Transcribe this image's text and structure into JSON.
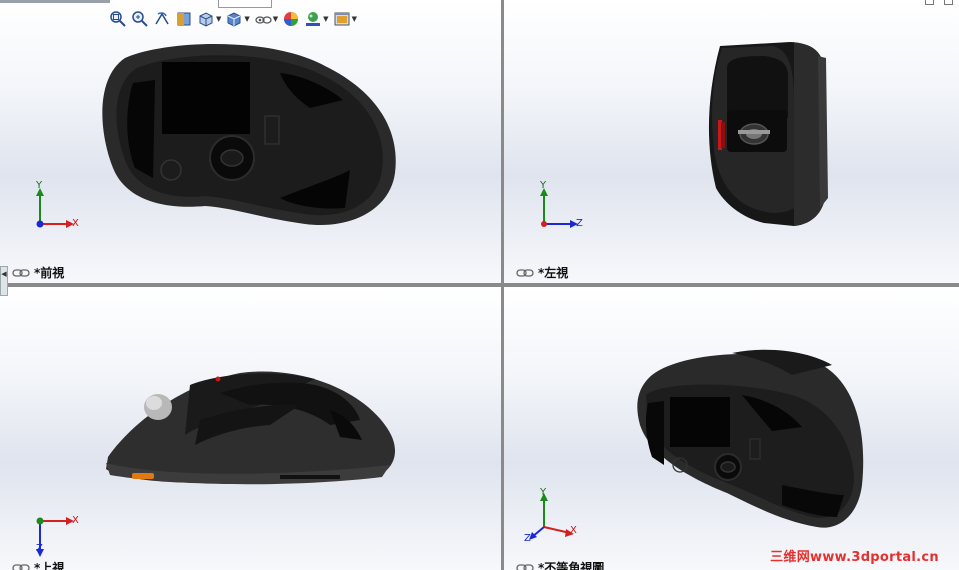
{
  "toolbar": {
    "buttons": [
      {
        "icon": "zoom-to-fit-icon",
        "dropdown": false
      },
      {
        "icon": "zoom-to-area-icon",
        "dropdown": false
      },
      {
        "icon": "previous-view-icon",
        "dropdown": false
      },
      {
        "icon": "section-view-icon",
        "dropdown": false
      },
      {
        "icon": "view-orientation-icon",
        "dropdown": true
      },
      {
        "icon": "display-style-icon",
        "dropdown": true
      },
      {
        "icon": "hide-show-items-icon",
        "dropdown": true
      },
      {
        "icon": "edit-appearance-icon",
        "dropdown": false
      },
      {
        "icon": "apply-scene-icon",
        "dropdown": true
      },
      {
        "icon": "view-settings-icon",
        "dropdown": true
      }
    ]
  },
  "viewports": {
    "front": {
      "label": "*前視",
      "axes": [
        "Y",
        "X"
      ]
    },
    "left": {
      "label": "*左視",
      "axes": [
        "Y",
        "Z"
      ]
    },
    "top": {
      "label": "*上視",
      "axes": [
        "X",
        "Z"
      ]
    },
    "iso": {
      "label": "*不等角視圖",
      "axes": [
        "Y",
        "X",
        "Z"
      ]
    }
  },
  "watermark": "三维网www.3dportal.cn",
  "colors": {
    "axis_x": "#d42020",
    "axis_y": "#1a8a1a",
    "axis_z": "#1a2ad0",
    "model_body": "#232323",
    "accent_red": "#c81818",
    "accent_orange": "#e07a10",
    "watermark": "#e53030"
  }
}
